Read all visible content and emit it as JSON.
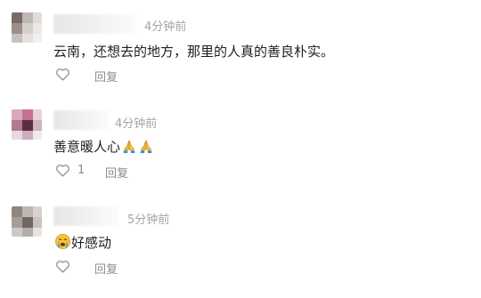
{
  "comments": [
    {
      "time": "4分钟前",
      "text": "云南，还想去的地方，那里的人真的善良朴实。",
      "likes": "",
      "reply_label": "回复"
    },
    {
      "time": "4分钟前",
      "text": "善意暖人心",
      "trailing_emojis": [
        "folded-hands",
        "folded-hands"
      ],
      "likes": "1",
      "reply_label": "回复"
    },
    {
      "time": "5分钟前",
      "leading_emoji": "crying-face",
      "text": "好感动",
      "likes": "",
      "reply_label": "回复"
    }
  ],
  "colors": {
    "text": "#1f1f1f",
    "meta": "#a3a3a3",
    "action": "#8c8c8c"
  }
}
